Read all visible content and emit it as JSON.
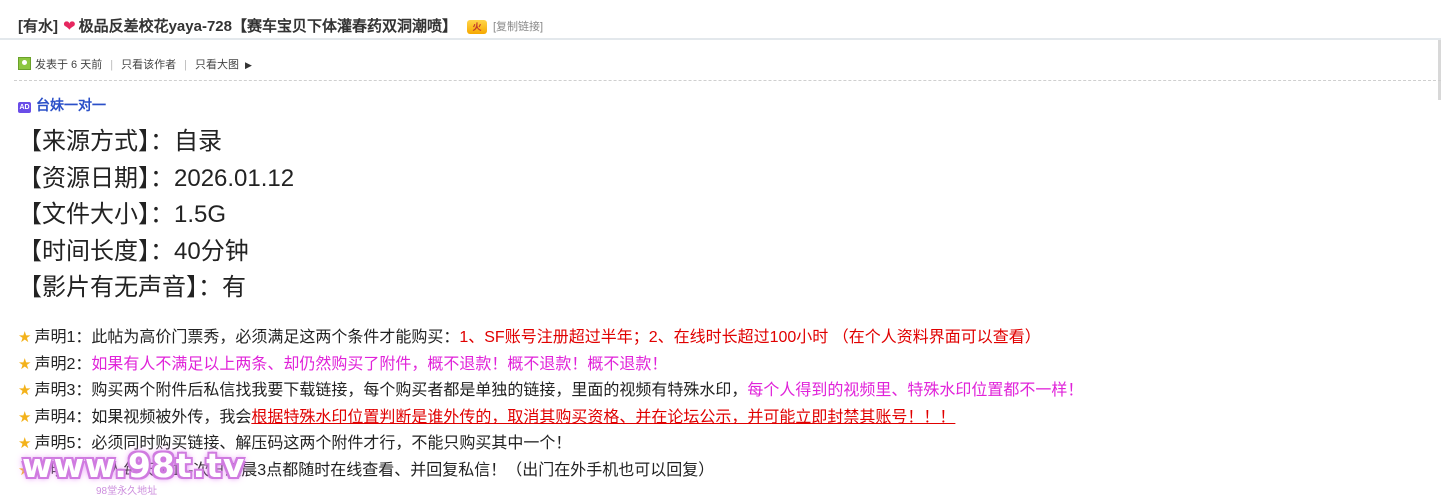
{
  "post": {
    "tag": "[有水]",
    "heart_icon": "heart-icon",
    "title": "极品反差校花yaya-728【赛车宝贝下体灌春药双洞潮喷】",
    "vip_badge_text": "火",
    "copy_link": "[复制链接]"
  },
  "meta": {
    "posted": "发表于 6 天前",
    "only_author": "只看该作者",
    "only_images": "只看大图",
    "arrow": "▶"
  },
  "ad": {
    "badge": "AD",
    "text": "台妹一对一"
  },
  "info": [
    {
      "label": "【来源方式】：",
      "value": "自录"
    },
    {
      "label": "【资源日期】：",
      "value": "2026.01.12"
    },
    {
      "label": "【文件大小】：",
      "value": "1.5G"
    },
    {
      "label": "【时间长度】：",
      "value": "40分钟"
    },
    {
      "label": "【影片有无声音】：",
      "value": "有"
    }
  ],
  "declarations": [
    {
      "prefix": "声明1：此帖为高价门票秀，必须满足这两个条件才能购买：",
      "highlight": "1、SF账号注册超过半年；2、在线时长超过100小时 （在个人资料界面可以查看）"
    },
    {
      "prefix": "声明2：",
      "highlight": "如果有人不满足以上两条、却仍然购买了附件，概不退款！概不退款！概不退款！"
    },
    {
      "prefix": "声明3：购买两个附件后私信找我要下载链接，每个购买者都是单独的链接，里面的视频有特殊水印，",
      "highlight": "每个人得到的视频里、特殊水印位置都不一样！"
    },
    {
      "prefix": "声明4：如果视频被外传，我会",
      "highlight": "根据特殊水印位置判断是谁外传的，取消其购买资格、并在论坛公示，并可能立即封禁其账号！！！"
    },
    {
      "prefix": "声明5：必须同时购买链接、解压码这两个附件才行，不能只购买其中一个！",
      "highlight": ""
    },
    {
      "prefix": "声明6：本人每天早11-次日凌晨3点都随时在线查看、并回复私信！（出门在外手机也可以回复）",
      "highlight": ""
    }
  ],
  "watermark": {
    "text": "www.98t.tv",
    "sub": "98堂永久地址"
  },
  "colors": {
    "link_blue": "#2b50c8",
    "red": "#e00000",
    "magenta": "#e023d9",
    "star": "#f3b21b"
  }
}
